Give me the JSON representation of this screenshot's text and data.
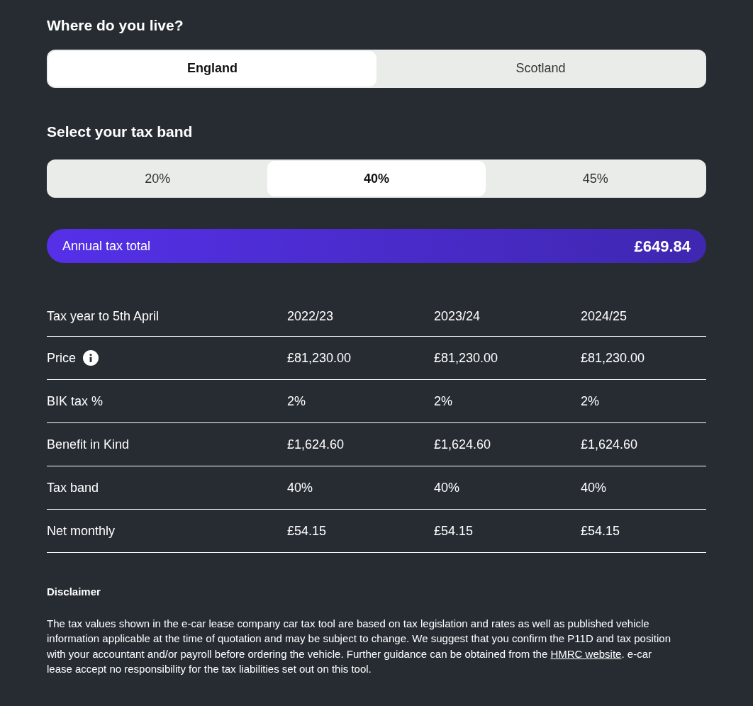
{
  "location": {
    "heading": "Where do you live?",
    "options": [
      {
        "label": "England",
        "selected": true
      },
      {
        "label": "Scotland",
        "selected": false
      }
    ]
  },
  "tax_band": {
    "heading": "Select your tax band",
    "options": [
      {
        "label": "20%",
        "selected": false
      },
      {
        "label": "40%",
        "selected": true
      },
      {
        "label": "45%",
        "selected": false
      }
    ]
  },
  "total": {
    "label": "Annual tax total",
    "value": "£649.84"
  },
  "table": {
    "columns": [
      "Tax year to 5th April",
      "2022/23",
      "2023/24",
      "2024/25"
    ],
    "rows": [
      {
        "info": true,
        "cells": [
          "Price",
          "£81,230.00",
          "£81,230.00",
          "£81,230.00"
        ]
      },
      {
        "info": false,
        "cells": [
          "BIK tax %",
          "2%",
          "2%",
          "2%"
        ]
      },
      {
        "info": false,
        "cells": [
          "Benefit in Kind",
          "£1,624.60",
          "£1,624.60",
          "£1,624.60"
        ]
      },
      {
        "info": false,
        "cells": [
          "Tax band",
          "40%",
          "40%",
          "40%"
        ]
      },
      {
        "info": false,
        "cells": [
          "Net monthly",
          "£54.15",
          "£54.15",
          "£54.15"
        ]
      }
    ]
  },
  "disclaimer": {
    "heading": "Disclaimer",
    "text_before": "The tax values shown in the e-car lease company car tax tool are based on tax legislation and rates as well as published vehicle information applicable at the time of quotation and may be subject to change. We suggest that you confirm the P11D and tax position with your accountant and/or payroll before ordering the vehicle. Further guidance can be obtained from the ",
    "link": "HMRC website",
    "text_after": ". e-car lease accept no responsibility for the tax liabilities set out on this tool."
  }
}
